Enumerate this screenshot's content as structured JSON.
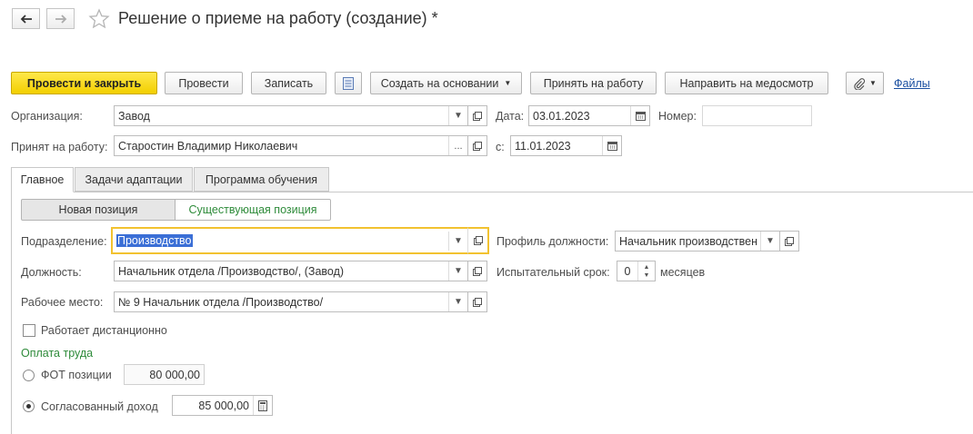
{
  "window": {
    "title": "Решение о приеме на работу (создание) *"
  },
  "toolbar": {
    "post_close": "Провести и закрыть",
    "post": "Провести",
    "save": "Записать",
    "create_based": "Создать на основании",
    "hire": "Принять на работу",
    "medical": "Направить на медосмотр",
    "files": "Файлы"
  },
  "header": {
    "org_label": "Организация:",
    "org_value": "Завод",
    "date_label": "Дата:",
    "date_value": "03.01.2023",
    "number_label": "Номер:",
    "number_value": "",
    "hired_label": "Принят на работу:",
    "hired_value": "Старостин Владимир Николаевич",
    "from_label": "с:",
    "from_value": "11.01.2023"
  },
  "tabs": [
    "Главное",
    "Задачи адаптации",
    "Программа обучения"
  ],
  "position_toggle": {
    "new": "Новая позиция",
    "existing": "Существующая позиция"
  },
  "main": {
    "dept_label": "Подразделение:",
    "dept_value": "Производство",
    "profile_label": "Профиль должности:",
    "profile_value": "Начальник производствен",
    "position_label": "Должность:",
    "position_value": "Начальник отдела /Производство/, (Завод)",
    "probation_label": "Испытательный срок:",
    "probation_value": "0",
    "probation_unit": "месяцев",
    "workplace_label": "Рабочее место:",
    "workplace_value": "№ 9 Начальник отдела /Производство/",
    "remote_label": "Работает дистанционно",
    "pay_section": "Оплата труда",
    "fot_label": "ФОТ позиции",
    "fot_value": "80 000,00",
    "agreed_label": "Согласованный доход",
    "agreed_value": "85 000,00"
  },
  "colors": {
    "primary_button": "#f5d400",
    "link": "#1a4fa0",
    "green_text": "#2e8b3a",
    "focus_border": "#f2c230",
    "selection": "#3b6fd6"
  }
}
